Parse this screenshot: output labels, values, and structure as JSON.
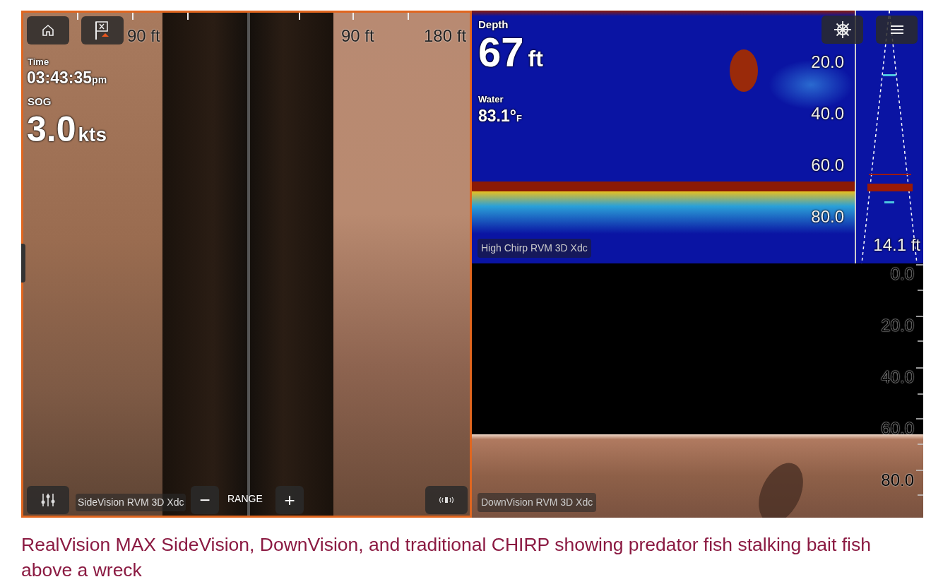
{
  "side_vision": {
    "selected": true,
    "range_labels": [
      "90 ft",
      "90 ft",
      "180 ft"
    ],
    "time": {
      "label": "Time",
      "value": "03:43:35",
      "suffix": "pm"
    },
    "sog": {
      "label": "SOG",
      "value": "3.0",
      "unit": "kts"
    },
    "source": "SideVision RVM 3D Xdc",
    "range": {
      "minus": "−",
      "label": "RANGE",
      "plus": "+"
    }
  },
  "chirp": {
    "depth": {
      "label": "Depth",
      "value": "67",
      "unit": "ft"
    },
    "water": {
      "label": "Water",
      "value": "83.1°",
      "unit": "F"
    },
    "depth_scale": [
      "20.0",
      "40.0",
      "60.0",
      "80.0"
    ],
    "cone_reading": "14.1 ft",
    "source": "High Chirp RVM 3D Xdc"
  },
  "down_vision": {
    "depth_scale": [
      "0.0",
      "20.0",
      "40.0",
      "60.0",
      "80.0"
    ],
    "source": "DownVision RVM 3D Xdc"
  },
  "caption": "RealVision MAX SideVision, DownVision, and traditional CHIRP showing predator fish stalking bait fish above a wreck"
}
